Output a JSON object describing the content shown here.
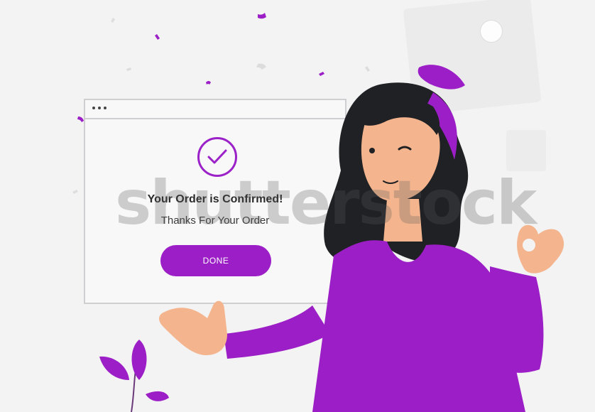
{
  "dialog": {
    "title": "Your Order is Confirmed!",
    "subtitle": "Thanks For Your Order",
    "button_label": "DONE",
    "icons": {
      "window_menu": "three-dots-icon",
      "status": "checkmark-circle-icon"
    }
  },
  "watermark": {
    "text": "shutterstock"
  },
  "colors": {
    "accent": "#9c1ec6",
    "background": "#f3f3f3",
    "dialog_bg": "#f8f8f8"
  }
}
